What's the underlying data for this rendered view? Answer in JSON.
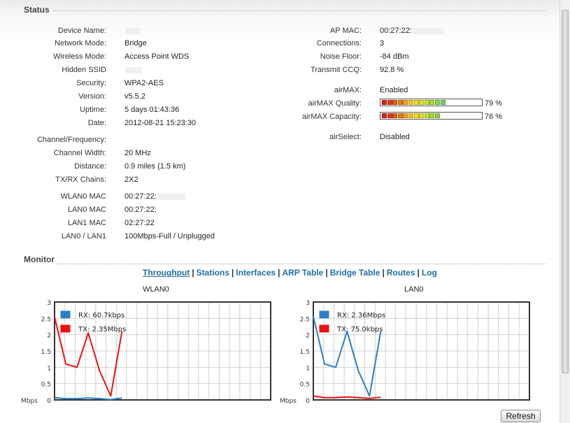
{
  "status": {
    "title": "Status",
    "left": [
      {
        "label": "Device Name:",
        "value": ""
      },
      {
        "label": "Network Mode:",
        "value": "Bridge"
      },
      {
        "label": "Wireless Mode:",
        "value": "Access Point WDS"
      },
      {
        "label": "Hidden SSID",
        "value": ""
      },
      {
        "label": "Security:",
        "value": "WPA2-AES"
      },
      {
        "label": "Version:",
        "value": "v5.5.2"
      },
      {
        "label": "Uptime:",
        "value": "5 days 01:43:36"
      },
      {
        "label": "Date:",
        "value": "2012-08-21 15:23:30"
      },
      {
        "label": "Channel/Frequency:",
        "value": ""
      },
      {
        "label": "Channel Width:",
        "value": "20 MHz"
      },
      {
        "label": "Distance:",
        "value": "0.9 miles (1.5 km)"
      },
      {
        "label": "TX/RX Chains:",
        "value": "2X2"
      },
      {
        "label": "WLAN0 MAC",
        "value": "00:27:22:"
      },
      {
        "label": "LAN0 MAC",
        "value": "00:27:22:"
      },
      {
        "label": "LAN1 MAC",
        "value": "02:27:22"
      },
      {
        "label": "LAN0 / LAN1",
        "value": "100Mbps-Full / Unplugged"
      }
    ],
    "right": [
      {
        "label": "AP MAC:",
        "value": "00:27:22:"
      },
      {
        "label": "Connections:",
        "value": "3"
      },
      {
        "label": "Noise Floor:",
        "value": "-84 dBm"
      },
      {
        "label": "Transmit CCQ:",
        "value": "92.8 %"
      },
      {
        "label": "airMAX:",
        "value": "Enabled"
      },
      {
        "label": "airMAX Quality:",
        "value": "79 %"
      },
      {
        "label": "airMAX Capacity:",
        "value": "76 %"
      },
      {
        "label": "airSelect:",
        "value": "Disabled"
      }
    ],
    "airmax_quality_pct": 79,
    "airmax_capacity_pct": 76
  },
  "monitor": {
    "title": "Monitor",
    "tabs": [
      "Throughput",
      "Stations",
      "Interfaces",
      "ARP Table",
      "Bridge Table",
      "Routes",
      "Log"
    ],
    "active_tab": "Throughput",
    "refresh_label": "Refresh"
  },
  "colors": {
    "rx": "#2a7fc4",
    "tx": "#ee1111",
    "link": "#1f6fa5"
  },
  "chart_data": [
    {
      "type": "line",
      "title": "WLAN0",
      "ylabel": "Mbps",
      "ylim": [
        0,
        3
      ],
      "yticks": [
        "0",
        "0.5",
        "1",
        "1.5",
        "2",
        "2.5",
        "3"
      ],
      "grid": true,
      "legend": "top-left",
      "series": [
        {
          "name": "RX: 60.7kbps",
          "color": "#2a7fc4",
          "values": [
            0.07,
            0.04,
            0.04,
            0.06,
            0.04,
            0.01,
            0.06
          ]
        },
        {
          "name": "TX: 2.35Mbps",
          "color": "#ee1111",
          "values": [
            2.55,
            1.1,
            1.0,
            2.05,
            0.9,
            0.12,
            2.1
          ]
        }
      ]
    },
    {
      "type": "line",
      "title": "LAN0",
      "ylabel": "Mbps",
      "ylim": [
        0,
        3
      ],
      "yticks": [
        "0",
        "0.5",
        "1",
        "1.5",
        "2",
        "2.5",
        "3"
      ],
      "grid": true,
      "legend": "top-left",
      "series": [
        {
          "name": "RX: 2.36Mbps",
          "color": "#2a7fc4",
          "values": [
            2.55,
            1.1,
            1.0,
            2.1,
            0.9,
            0.12,
            2.1
          ]
        },
        {
          "name": "TX: 75.0kbps",
          "color": "#ee1111",
          "values": [
            0.12,
            0.07,
            0.07,
            0.09,
            0.07,
            0.05,
            0.08
          ]
        }
      ]
    }
  ]
}
